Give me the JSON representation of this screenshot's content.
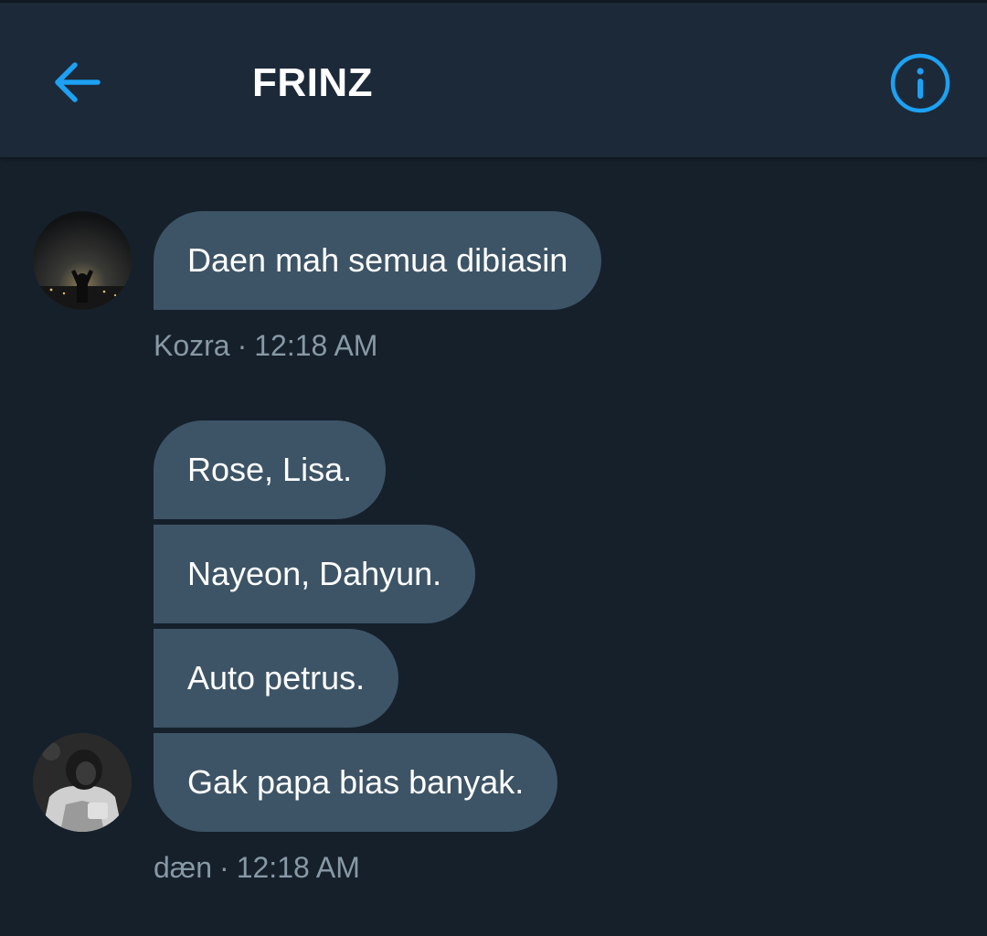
{
  "header": {
    "title": "FRINZ",
    "back_icon": "arrow-left-icon",
    "info_icon": "info-circle-icon",
    "accent_color": "#1da1f2"
  },
  "messages": [
    {
      "sender": "Kozra",
      "time": "12:18 AM",
      "separator": "·",
      "bubbles": [
        "Daen mah semua dibiasin"
      ]
    },
    {
      "sender": "dæn",
      "time": "12:18 AM",
      "separator": "·",
      "bubbles": [
        "Rose, Lisa.",
        "Nayeon, Dahyun.",
        "Auto petrus.",
        "Gak papa bias banyak."
      ]
    }
  ],
  "colors": {
    "background": "#15202b",
    "header_background": "#1c2938",
    "bubble": "#3d5466",
    "meta_text": "#8899a6"
  }
}
